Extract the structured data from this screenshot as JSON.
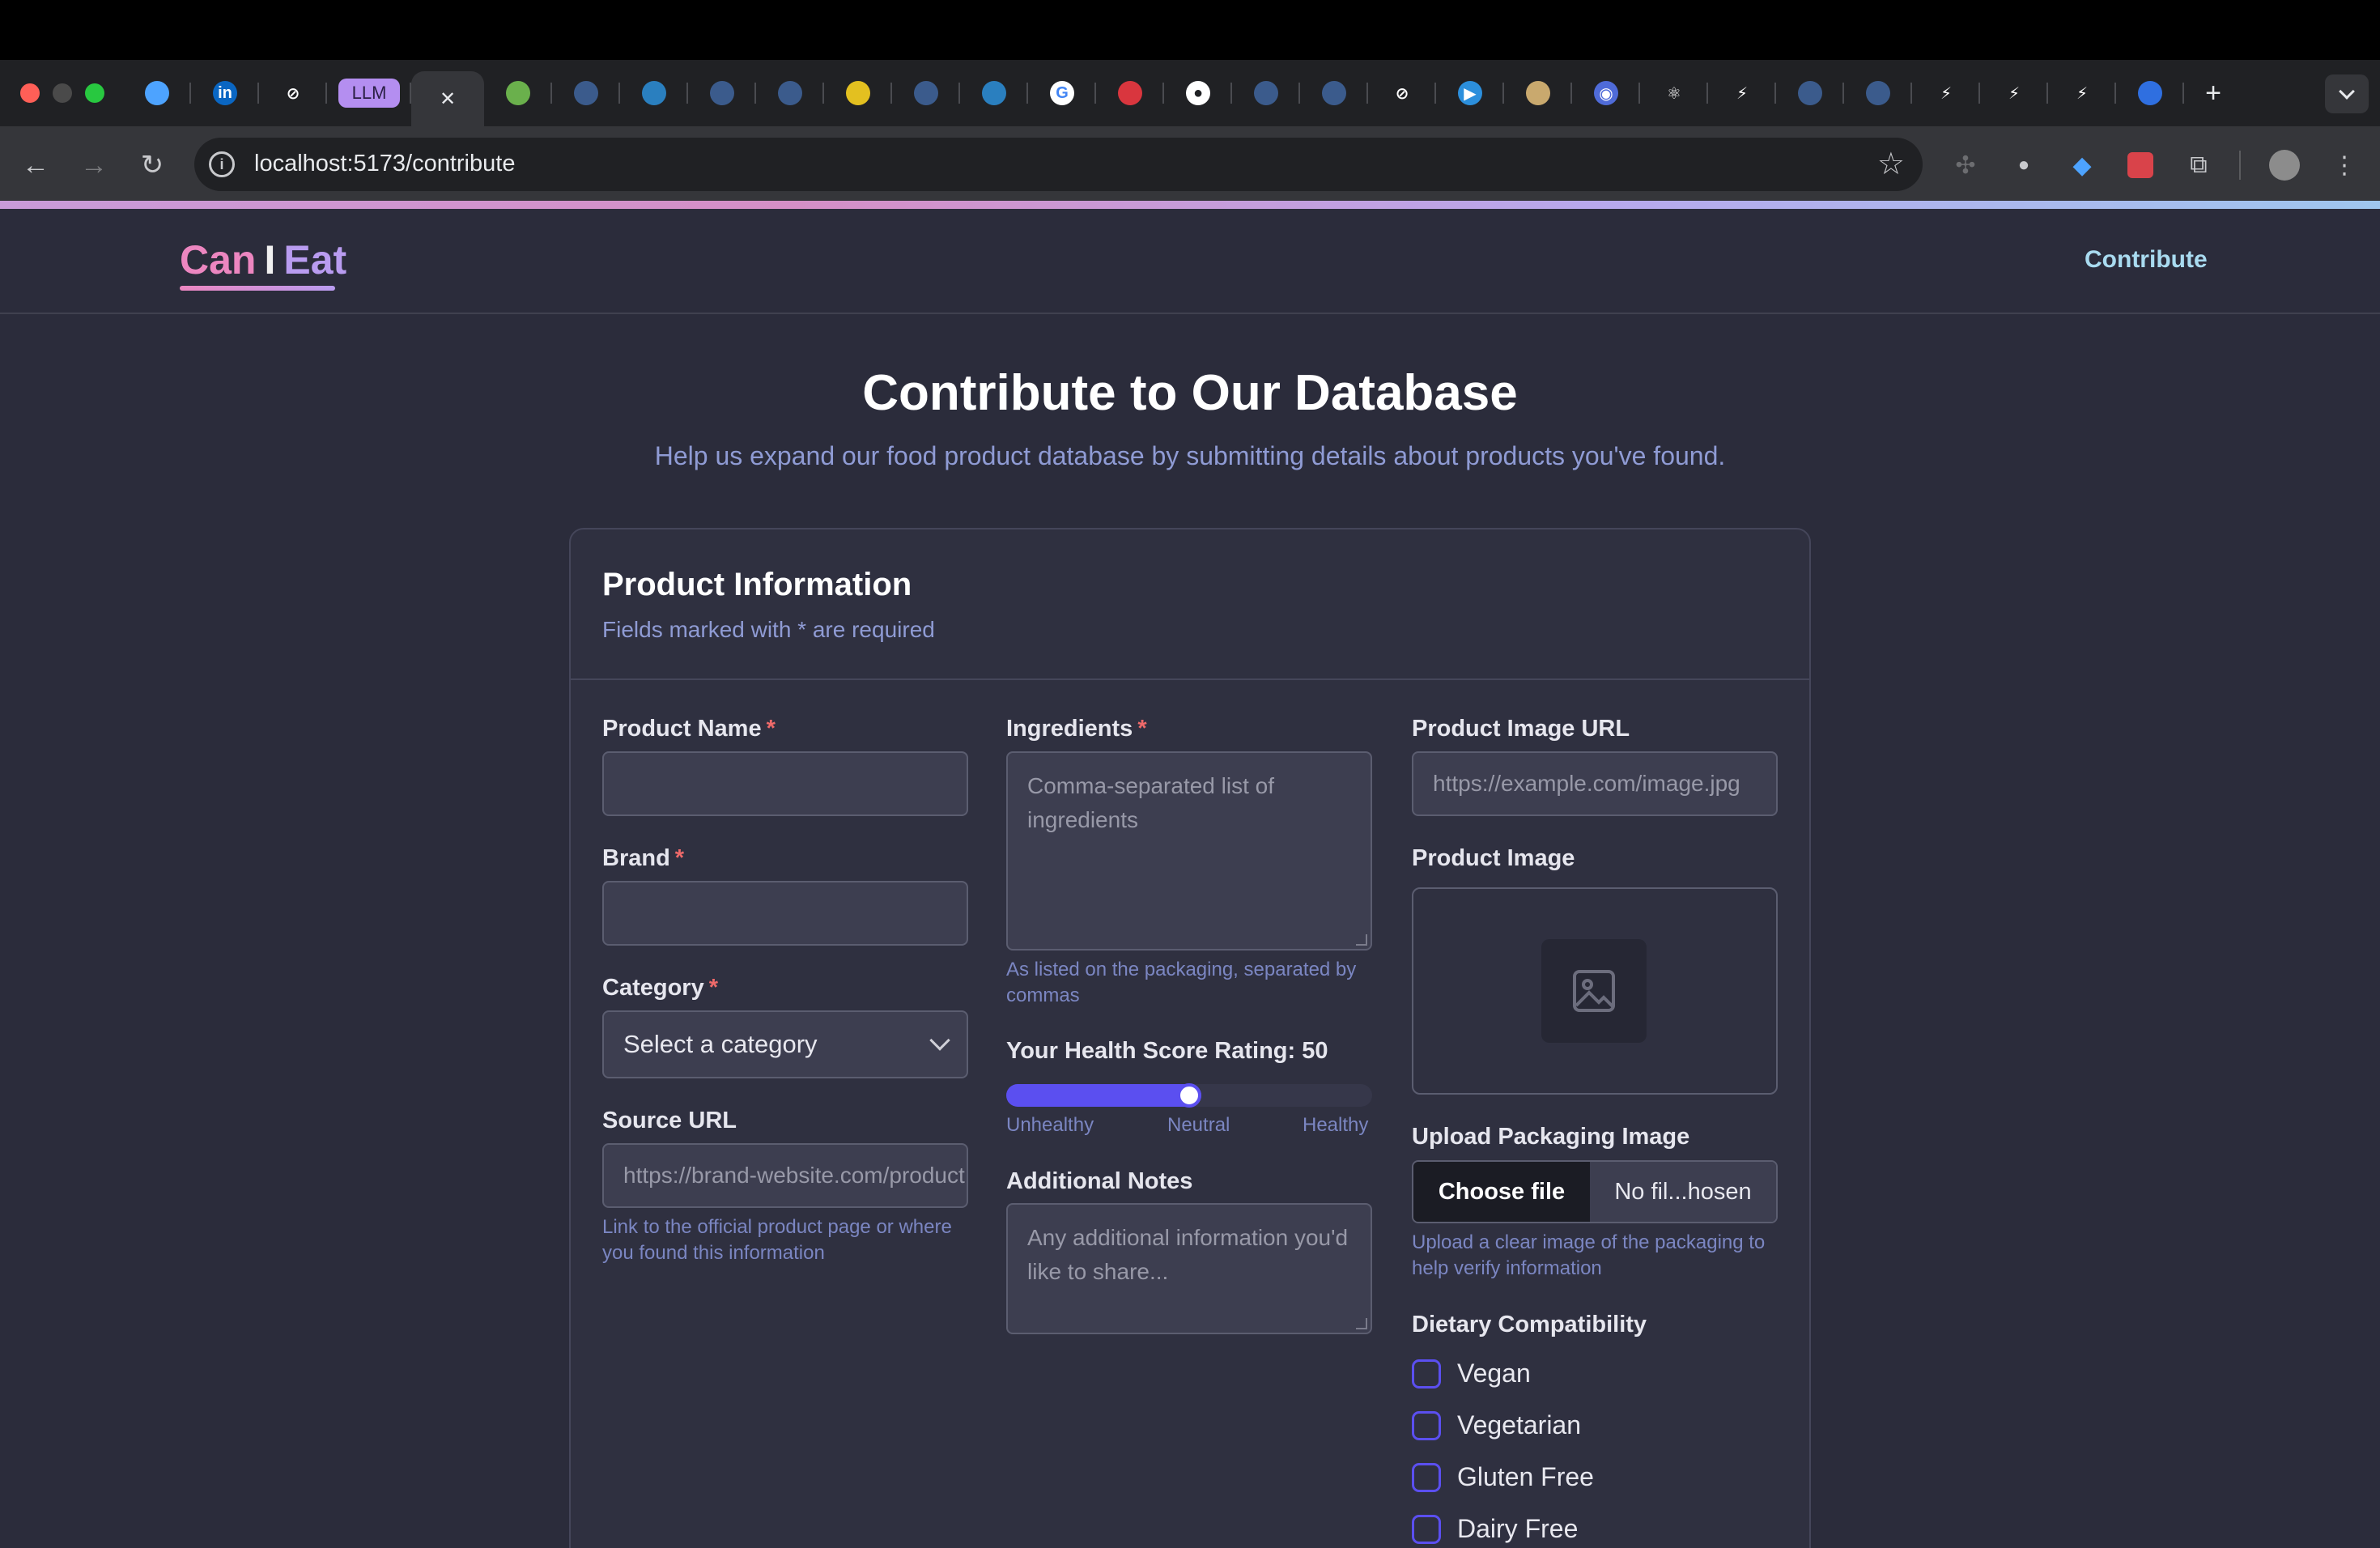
{
  "browser": {
    "url": "localhost:5173/contribute",
    "tabs": [
      {
        "icon": "gem-icon"
      },
      {
        "icon": "linkedin-icon",
        "text": "in"
      },
      {
        "icon": "openai-icon"
      },
      {
        "icon": "llm-icon",
        "text": "LLM"
      },
      {
        "icon": "close-icon",
        "text": "✕",
        "active": true
      },
      {
        "icon": "chart-icon"
      },
      {
        "icon": "globe-icon"
      },
      {
        "icon": "swift-icon"
      },
      {
        "icon": "globe-icon"
      },
      {
        "icon": "globe-icon"
      },
      {
        "icon": "smile-icon"
      },
      {
        "icon": "globe-icon"
      },
      {
        "icon": "swift-icon"
      },
      {
        "icon": "google-icon",
        "text": "G"
      },
      {
        "icon": "nt-icon"
      },
      {
        "icon": "github-icon"
      },
      {
        "icon": "globe-icon"
      },
      {
        "icon": "globe-icon"
      },
      {
        "icon": "openai-icon"
      },
      {
        "icon": "play-icon"
      },
      {
        "icon": "avatar-icon"
      },
      {
        "icon": "chat-icon"
      },
      {
        "icon": "react-icon"
      },
      {
        "icon": "bolt-icon"
      },
      {
        "icon": "globe-icon"
      },
      {
        "icon": "globe-icon"
      },
      {
        "icon": "bolt-icon"
      },
      {
        "icon": "bolt-icon"
      },
      {
        "icon": "bolt-icon"
      },
      {
        "icon": "shield-icon"
      }
    ],
    "new_tab_symbol": "+"
  },
  "app": {
    "logo": {
      "can": "Can",
      "i": "I",
      "eat": "Eat"
    },
    "nav_contribute": "Contribute"
  },
  "page": {
    "title": "Contribute to Our Database",
    "subtitle": "Help us expand our food product database by submitting details about products you've found."
  },
  "card": {
    "title": "Product Information",
    "subtitle": "Fields marked with * are required"
  },
  "form": {
    "product_name": {
      "label": "Product Name",
      "req": "*",
      "value": ""
    },
    "brand": {
      "label": "Brand",
      "req": "*",
      "value": ""
    },
    "category": {
      "label": "Category",
      "req": "*",
      "selected": "Select a category"
    },
    "source_url": {
      "label": "Source URL",
      "placeholder": "https://brand-website.com/product",
      "help": "Link to the official product page or where you found this information"
    },
    "ingredients": {
      "label": "Ingredients",
      "req": "*",
      "placeholder": "Comma-separated list of ingredients",
      "help": "As listed on the packaging, separated by commas"
    },
    "health_score": {
      "label": "Your Health Score Rating: 50",
      "value": 50,
      "min": 0,
      "max": 100,
      "ticks": [
        "Unhealthy",
        "Neutral",
        "Healthy"
      ]
    },
    "notes": {
      "label": "Additional Notes",
      "placeholder": "Any additional information you'd like to share..."
    },
    "image_url": {
      "label": "Product Image URL",
      "placeholder": "https://example.com/image.jpg"
    },
    "product_image": {
      "label": "Product Image"
    },
    "upload": {
      "label": "Upload Packaging Image",
      "button": "Choose file",
      "status": "No fil...hosen",
      "help": "Upload a clear image of the packaging to help verify information"
    },
    "dietary": {
      "label": "Dietary Compatibility",
      "options": [
        "Vegan",
        "Vegetarian",
        "Gluten Free",
        "Dairy Free"
      ]
    }
  },
  "colors": {
    "accent": "#5b4ff0",
    "logo_pink": "#ec86c0",
    "logo_purple": "#b99cf0",
    "help_text": "#7b86c2",
    "required": "#ef6a6a"
  }
}
